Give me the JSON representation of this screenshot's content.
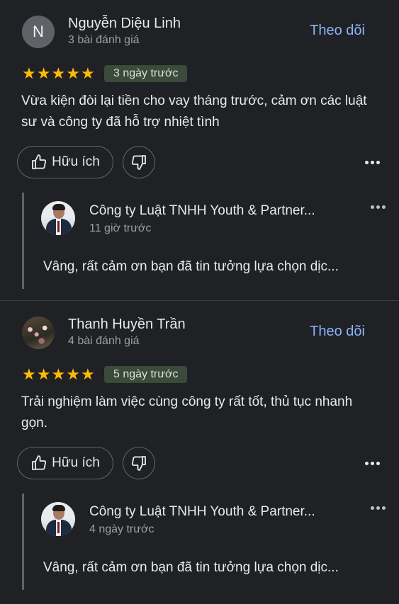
{
  "reviews": [
    {
      "reviewer_name": "Nguyễn Diệu Linh",
      "reviewer_initial": "N",
      "reviewer_sub": "3 bài đánh giá",
      "follow_label": "Theo dõi",
      "rating": 5,
      "date": "3 ngày trước",
      "text": "Vừa kiện đòi lại tiền cho vay tháng trước, cảm ơn các luật sư và công ty đã hỗ trợ nhiệt tình",
      "helpful_label": "Hữu ích",
      "reply": {
        "name": "Công ty Luật TNHH Youth & Partner...",
        "time": "11 giờ trước",
        "text": "Vâng, rất cảm ơn bạn đã tin tưởng lựa chọn dịc..."
      }
    },
    {
      "reviewer_name": "Thanh Huyền Trần",
      "reviewer_sub": "4 bài đánh giá",
      "follow_label": "Theo dõi",
      "rating": 5,
      "date": "5 ngày trước",
      "text": "Trải nghiệm làm việc cùng công ty rất tốt, thủ tục nhanh gọn.",
      "helpful_label": "Hữu ích",
      "reply": {
        "name": "Công ty Luật TNHH Youth & Partner...",
        "time": "4 ngày trước",
        "text": "Vâng, rất cảm ơn bạn đã tin tưởng lựa chọn dịc..."
      }
    }
  ],
  "icons": {
    "star": "star-icon",
    "thumbs_up": "thumbs-up-icon",
    "thumbs_down": "thumbs-down-icon",
    "more": "more-horizontal-icon"
  },
  "colors": {
    "background": "#202124",
    "star": "#fbbc04",
    "link": "#8ab4f8",
    "badge_bg": "#3a4a3b"
  }
}
